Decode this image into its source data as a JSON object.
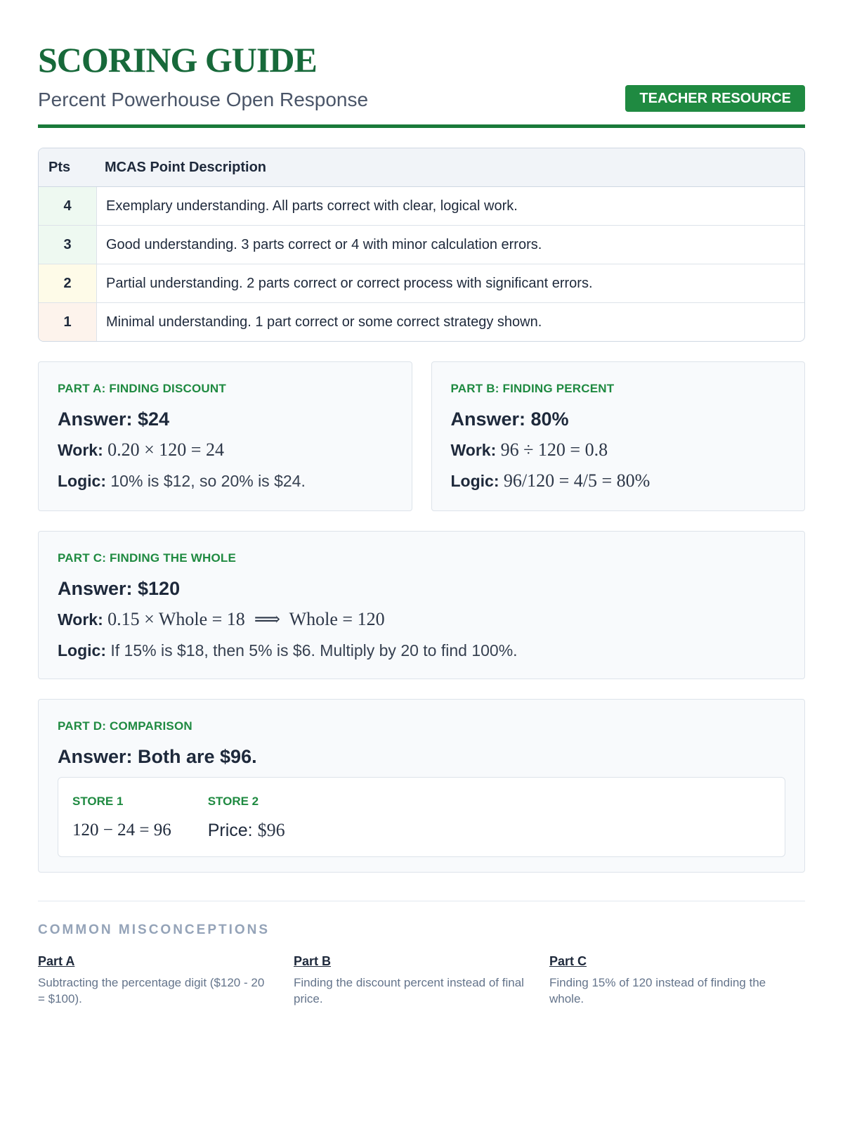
{
  "header": {
    "title": "SCORING GUIDE",
    "subtitle": "Percent Powerhouse Open Response",
    "badge": "TEACHER RESOURCE"
  },
  "colors": {
    "accent": "#1f8a41",
    "title": "#17693a",
    "muted": "#94a3b8"
  },
  "rubric": {
    "headers": [
      "Pts",
      "MCAS Point Description"
    ],
    "rows": [
      {
        "pts": "4",
        "desc": "Exemplary understanding. All parts correct with clear, logical work.",
        "tint": "#eef9f1"
      },
      {
        "pts": "3",
        "desc": "Good understanding. 3 parts correct or 4 with minor calculation errors.",
        "tint": "#eef9f1"
      },
      {
        "pts": "2",
        "desc": "Partial understanding. 2 parts correct or correct process with significant errors.",
        "tint": "#fefbe8"
      },
      {
        "pts": "1",
        "desc": "Minimal understanding. 1 part correct or some correct strategy shown.",
        "tint": "#fdf3ec"
      }
    ]
  },
  "parts": {
    "a": {
      "label": "PART A: FINDING DISCOUNT",
      "answer": "Answer: $24",
      "work_label": "Work:",
      "work": "0.20 × 120 = 24",
      "logic_label": "Logic:",
      "logic": "10% is $12, so 20% is $24."
    },
    "b": {
      "label": "PART B: FINDING PERCENT",
      "answer": "Answer: 80%",
      "work_label": "Work:",
      "work": "96 ÷ 120 = 0.8",
      "logic_label": "Logic:",
      "logic": "96/120 = 4/5 = 80%"
    },
    "c": {
      "label": "PART C: FINDING THE WHOLE",
      "answer": "Answer: $120",
      "work_label": "Work:",
      "work": "0.15 × Whole = 18  ⟹  Whole = 120",
      "logic_label": "Logic:",
      "logic": "If 15% is $18, then 5% is $6. Multiply by 20 to find 100%."
    },
    "d": {
      "label": "PART D: COMPARISON",
      "answer": "Answer: Both are $96.",
      "store1_label": "STORE 1",
      "store1_value": "120 − 24 = 96",
      "store2_label": "STORE 2",
      "store2_text": "Price: ",
      "store2_value": "$96"
    }
  },
  "misconceptions": {
    "title": "COMMON MISCONCEPTIONS",
    "items": [
      {
        "head": "Part A",
        "text": "Subtracting the percentage digit ($120 - 20 = $100)."
      },
      {
        "head": "Part B",
        "text": "Finding the discount percent instead of final price."
      },
      {
        "head": "Part C",
        "text": "Finding 15% of 120 instead of finding the whole."
      }
    ]
  }
}
